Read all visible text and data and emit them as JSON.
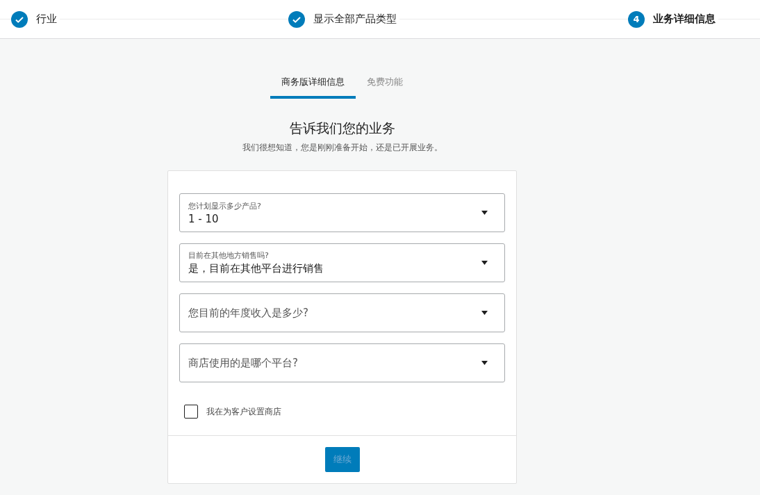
{
  "steps": [
    {
      "label": "行业",
      "completed": true
    },
    {
      "label": "显示全部产品类型",
      "completed": true
    },
    {
      "label": "业务详细信息",
      "completed": false,
      "number": "4"
    }
  ],
  "tabs": [
    {
      "label": "商务版详细信息",
      "selected": true
    },
    {
      "label": "免费功能",
      "selected": false
    }
  ],
  "heading": "告诉我们您的业务",
  "subheading": "我们很想知道，您是刚刚准备开始，还是已开展业务。",
  "selects": [
    {
      "label": "您计划显示多少产品?",
      "value": "1 - 10"
    },
    {
      "label": "目前在其他地方销售吗?",
      "value": "是，目前在其他平台进行销售"
    },
    {
      "placeholder": "您目前的年度收入是多少?"
    },
    {
      "placeholder": "商店使用的是哪个平台?"
    }
  ],
  "checkbox": {
    "label": "我在为客户设置商店",
    "checked": false
  },
  "continue_button": {
    "label": "继续",
    "disabled": true
  }
}
